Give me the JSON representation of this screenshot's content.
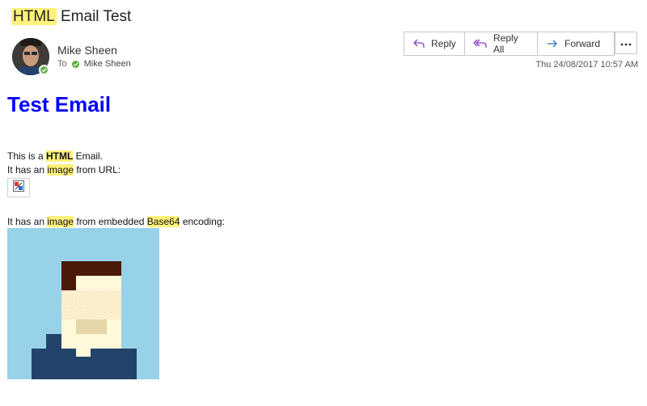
{
  "email": {
    "subject_highlight": "HTML",
    "subject_rest": " Email Test",
    "sender": "Mike Sheen",
    "to_label": "To",
    "recipient": "Mike Sheen",
    "timestamp": "Thu 24/08/2017 10:57 AM"
  },
  "toolbar": {
    "reply_label": "Reply",
    "reply_all_label": "Reply All",
    "forward_label": "Forward",
    "more_icon": "more-icon"
  },
  "content": {
    "heading": "Test Email",
    "line1_pre": "This is a ",
    "line1_bold": "HTML",
    "line1_post": " Email.",
    "line2_pre": "It has an ",
    "line2_hl": "image",
    "line2_post": " from URL:",
    "line3_pre": "It has an ",
    "line3_hl": "image",
    "line3_mid": " from embedded ",
    "line3_hl2": "Base64",
    "line3_post": " encoding:"
  },
  "colors": {
    "highlight": "#fff27a",
    "heading": "#0000ff",
    "presence": "#5fb043",
    "pixel_bg": "#97d2e8",
    "pixel_hair": "#4a1a08",
    "pixel_skin": "#fff8d9",
    "pixel_shirt": "#24436b"
  }
}
